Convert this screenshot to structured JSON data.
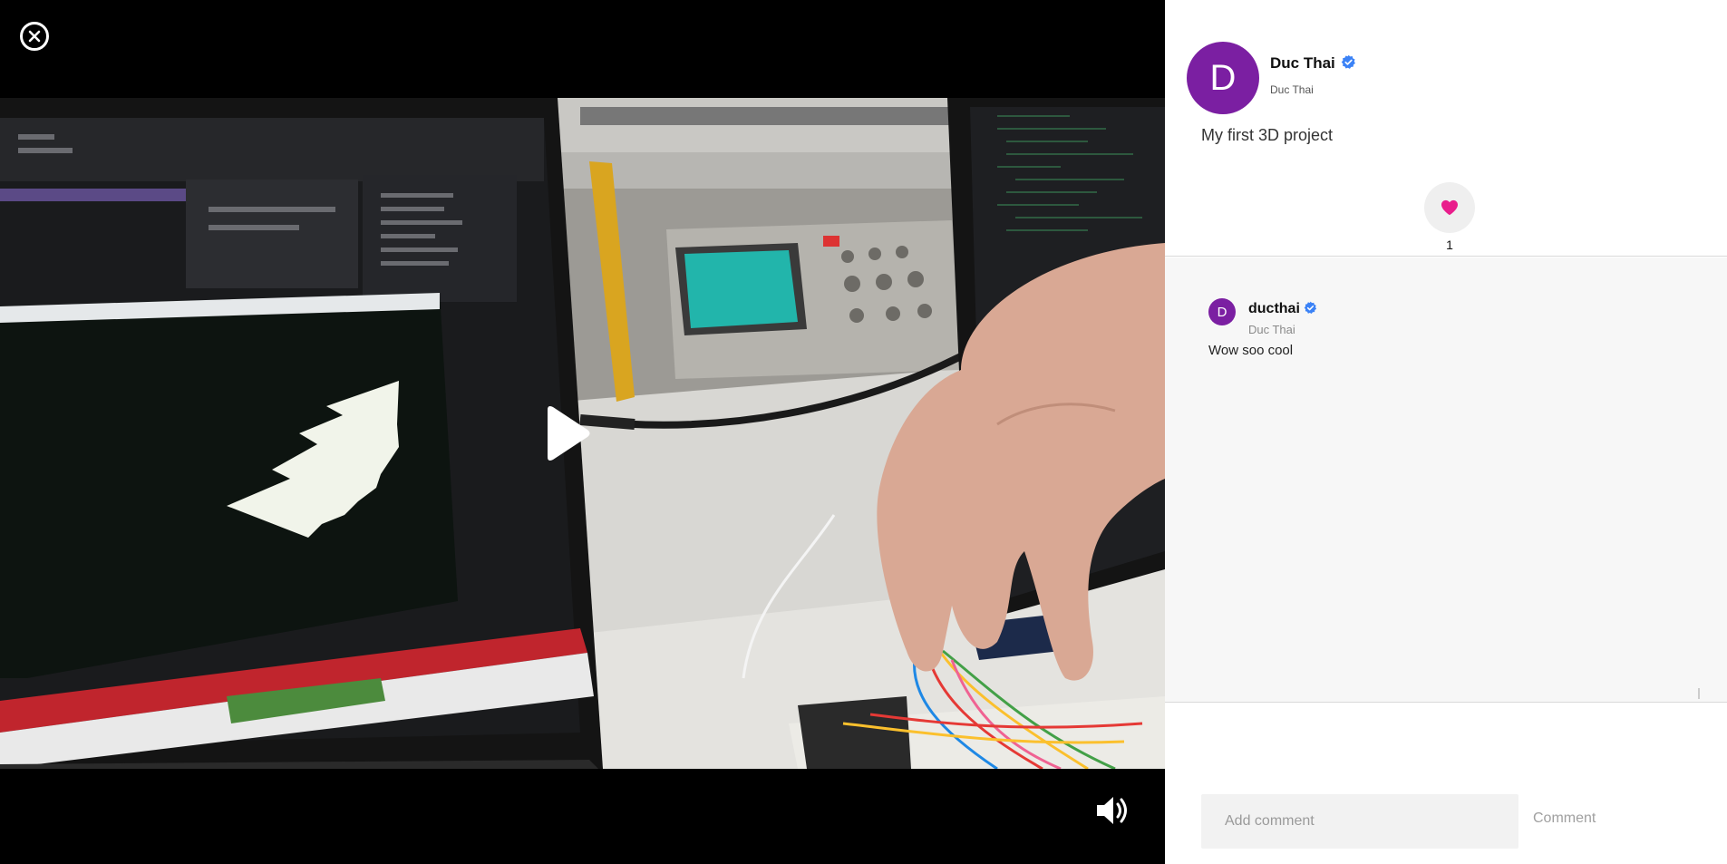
{
  "video": {
    "close_icon": "close-circle-icon",
    "play_icon": "play-icon",
    "volume_icon": "volume-up-icon"
  },
  "post": {
    "author": {
      "avatar_letter": "D",
      "name": "Duc Thai",
      "handle": "Duc Thai",
      "verified": true,
      "avatar_color": "#7b1fa2"
    },
    "caption": "My first 3D project",
    "likes": {
      "count": "1",
      "icon": "heart-icon",
      "color": "#e91e8c"
    }
  },
  "comments": [
    {
      "avatar_letter": "D",
      "username": "ducthai",
      "verified": true,
      "handle": "Duc Thai",
      "text": "Wow soo cool"
    }
  ],
  "composer": {
    "placeholder": "Add comment",
    "submit_label": "Comment"
  },
  "colors": {
    "verified_badge": "#3b82f6",
    "video_bg": "#000000"
  }
}
